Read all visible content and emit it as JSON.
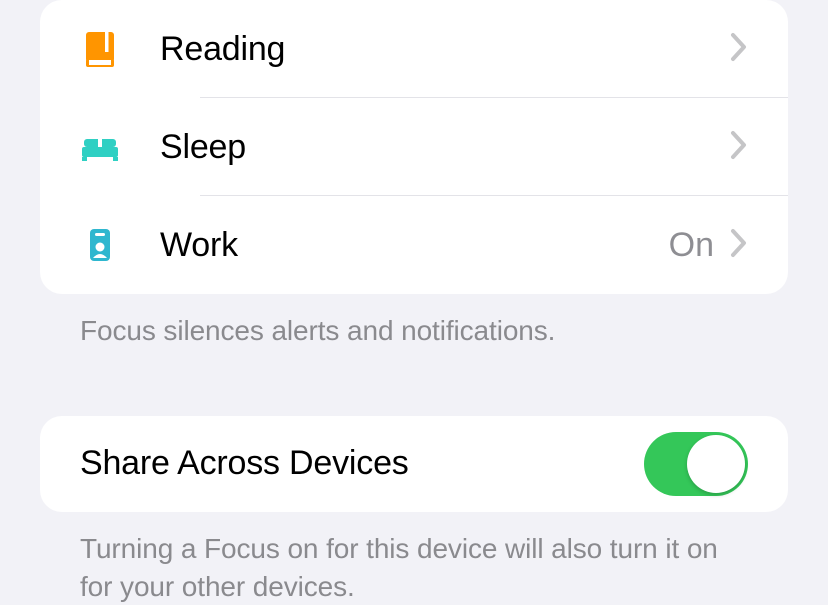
{
  "focus_list": {
    "items": [
      {
        "label": "Reading",
        "status": ""
      },
      {
        "label": "Sleep",
        "status": ""
      },
      {
        "label": "Work",
        "status": "On"
      }
    ],
    "footer": "Focus silences alerts and notifications."
  },
  "share": {
    "label": "Share Across Devices",
    "footer": "Turning a Focus on for this device will also turn it on for your other devices.",
    "enabled": true
  },
  "colors": {
    "reading_icon": "#ff9500",
    "sleep_icon": "#30d0c3",
    "work_icon": "#30d0c3",
    "switch_on": "#34c759"
  }
}
